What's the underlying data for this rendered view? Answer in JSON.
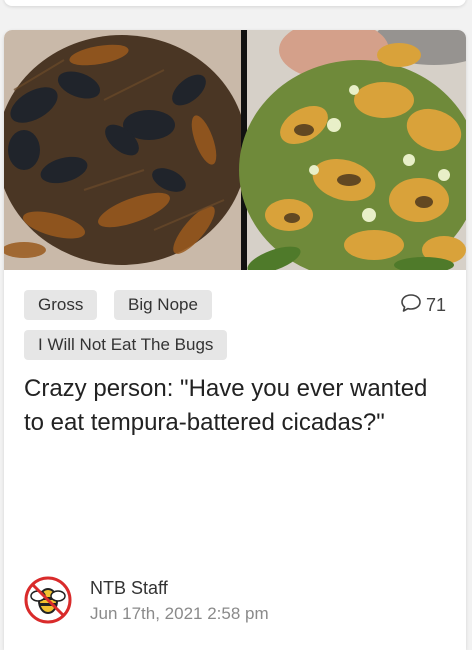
{
  "tags": [
    "Gross",
    "Big Nope",
    "I Will Not Eat The Bugs"
  ],
  "comments": {
    "count": "71",
    "icon": "speech-bubble-icon"
  },
  "headline": "Crazy person: \"Have you ever wanted to eat tempura-battered cicadas?\"",
  "author": {
    "name": "NTB Staff",
    "date": "Jun 17th, 2021 2:58 pm",
    "avatar_icon": "bee-logo-icon"
  },
  "colors": {
    "card": "#ffffff",
    "tag_bg": "#e6e6e6",
    "logo_red": "#d92b2b",
    "date_gray": "#8a8a8a"
  }
}
